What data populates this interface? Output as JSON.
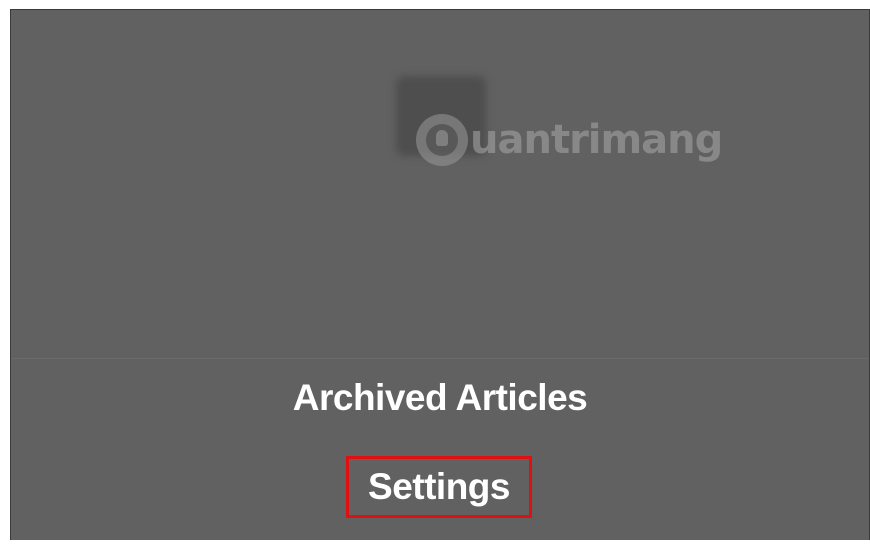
{
  "watermark": {
    "brand": "uantrimang"
  },
  "menu": {
    "archived_articles_label": "Archived Articles",
    "settings_label": "Settings"
  },
  "colors": {
    "overlay_background": "#616161",
    "highlight_box": "#e01010",
    "menu_text": "#ffffff"
  },
  "icons": {
    "empty_state": "empty-state-icon",
    "watermark_logo": "lightbulb-logo-icon"
  }
}
